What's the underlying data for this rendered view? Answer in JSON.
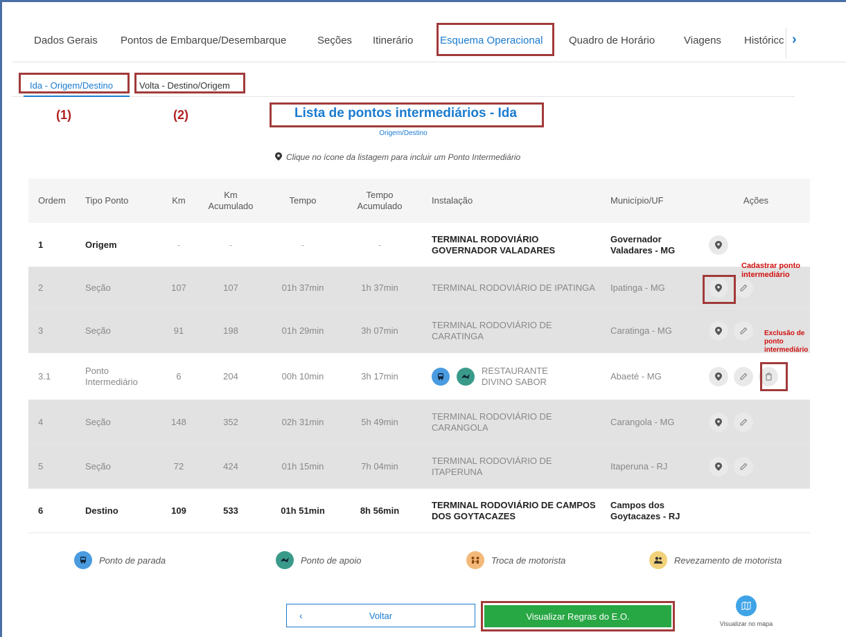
{
  "tabs": [
    {
      "label": "Dados Gerais"
    },
    {
      "label": "Pontos de Embarque/Desembarque"
    },
    {
      "label": "Seções"
    },
    {
      "label": "Itinerário"
    },
    {
      "label": "Esquema Operacional"
    },
    {
      "label": "Quadro de Horário"
    },
    {
      "label": "Viagens"
    },
    {
      "label": "Históricc"
    }
  ],
  "active_tab": "Esquema Operacional",
  "subtabs": [
    {
      "label": "Ida - Origem/Destino"
    },
    {
      "label": "Volta - Destino/Origem"
    }
  ],
  "markers": [
    "(1)",
    "(2)"
  ],
  "list_title": "Lista de pontos intermediários - Ida",
  "list_subtitle": "Origem/Destino",
  "hint": "Clique no ícone da listagem para incluir um Ponto Intermediário",
  "table": {
    "headers": {
      "ordem": "Ordem",
      "tipo": "Tipo Ponto",
      "km": "Km",
      "km_acc": "Km Acumulado",
      "tempo": "Tempo",
      "tempo_acc": "Tempo Acumulado",
      "instalacao": "Instalação",
      "municipio": "Município/UF",
      "acoes": "Ações"
    },
    "rows": [
      {
        "ordem": "1",
        "tipo": "Origem",
        "km": "-",
        "km_acc": "-",
        "tempo": "-",
        "tempo_acc": "-",
        "instalacao": "TERMINAL RODOVIÁRIO GOVERNADOR VALADARES",
        "municipio": "Governador Valadares - MG"
      },
      {
        "ordem": "2",
        "tipo": "Seção",
        "km": "107",
        "km_acc": "107",
        "tempo": "01h 37min",
        "tempo_acc": "1h 37min",
        "instalacao": "TERMINAL RODOVIÁRIO DE IPATINGA",
        "municipio": "Ipatinga - MG"
      },
      {
        "ordem": "3",
        "tipo": "Seção",
        "km": "91",
        "km_acc": "198",
        "tempo": "01h 29min",
        "tempo_acc": "3h 07min",
        "instalacao": "TERMINAL RODOVIÁRIO DE CARATINGA",
        "municipio": "Caratinga - MG"
      },
      {
        "ordem": "3.1",
        "tipo": "Ponto Intermediário",
        "km": "6",
        "km_acc": "204",
        "tempo": "00h 10min",
        "tempo_acc": "3h 17min",
        "instalacao": "RESTAURANTE DIVINO SABOR",
        "municipio": "Abaeté - MG"
      },
      {
        "ordem": "4",
        "tipo": "Seção",
        "km": "148",
        "km_acc": "352",
        "tempo": "02h 31min",
        "tempo_acc": "5h 49min",
        "instalacao": "TERMINAL RODOVIÁRIO DE CARANGOLA",
        "municipio": "Carangola - MG"
      },
      {
        "ordem": "5",
        "tipo": "Seção",
        "km": "72",
        "km_acc": "424",
        "tempo": "01h 15min",
        "tempo_acc": "7h 04min",
        "instalacao": "TERMINAL RODOVIÁRIO DE ITAPERUNA",
        "municipio": "Itaperuna - RJ"
      },
      {
        "ordem": "6",
        "tipo": "Destino",
        "km": "109",
        "km_acc": "533",
        "tempo": "01h 51min",
        "tempo_acc": "8h 56min",
        "instalacao": "TERMINAL RODOVIÁRIO DE CAMPOS DOS GOYTACAZES",
        "municipio": "Campos dos Goytacazes - RJ"
      }
    ]
  },
  "annotations": {
    "cadastrar": "Cadastrar ponto intermediário",
    "exclusao": "Exclusão de ponto intermediário"
  },
  "legend": [
    {
      "label": "Ponto de parada",
      "icon": "bus-icon",
      "color": "#4a9be0"
    },
    {
      "label": "Ponto de apoio",
      "icon": "support-icon",
      "color": "#3a9a8a"
    },
    {
      "label": "Troca de motorista",
      "icon": "driver-swap-icon",
      "color": "#f3b97a"
    },
    {
      "label": "Revezamento de motorista",
      "icon": "driver-relay-icon",
      "color": "#f1d27a"
    }
  ],
  "buttons": {
    "back_label": "Voltar",
    "rules_label": "Visualizar Regras do E.O.",
    "map_label": "Visualizar no mapa"
  },
  "colors": {
    "accent": "#1a7bd0",
    "highlight_box": "#a13a3a",
    "annotation_text": "#d01010",
    "primary_button": "#28a745"
  }
}
